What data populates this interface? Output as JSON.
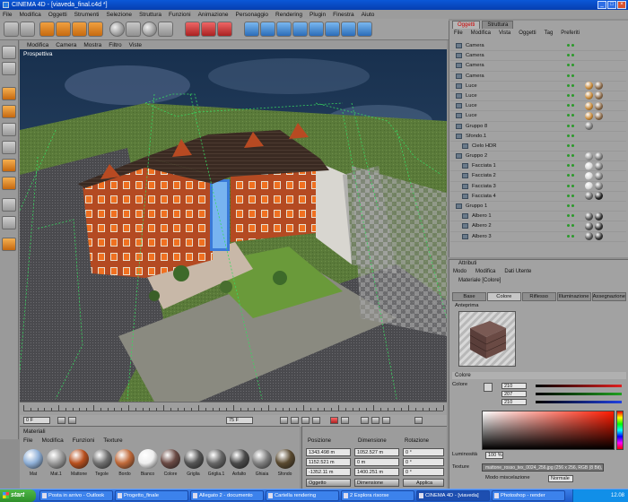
{
  "window": {
    "title": "CINEMA 4D - [viaveda_final.c4d *]"
  },
  "menu": [
    "File",
    "Modifica",
    "Oggetti",
    "Strumenti",
    "Selezione",
    "Struttura",
    "Funzioni",
    "Animazione",
    "Personaggio",
    "Rendering",
    "Plugin",
    "Finestra",
    "Aiuto"
  ],
  "viewport": {
    "menu": [
      "Modifica",
      "Camera",
      "Mostra",
      "Filtro",
      "Viste"
    ],
    "label": "Prospettiva"
  },
  "timeline": {
    "start_field": "0 F",
    "end_field": "75 F"
  },
  "material_manager": {
    "title": "Materiali",
    "menu": [
      "File",
      "Modifica",
      "Funzioni",
      "Texture"
    ],
    "materials": [
      {
        "name": "Mat",
        "color": "#8fb0d8"
      },
      {
        "name": "Mat.1",
        "color": "#9a9a9a"
      },
      {
        "name": "Mattone",
        "color": "#b8501e"
      },
      {
        "name": "Tegole",
        "color": "#707070"
      },
      {
        "name": "Bordo",
        "color": "#c06a3a"
      },
      {
        "name": "Bianco",
        "color": "#eeeeee"
      },
      {
        "name": "Colore",
        "color": "#6a4a44"
      },
      {
        "name": "Griglia",
        "color": "#555555"
      },
      {
        "name": "Griglia.1",
        "color": "#666666"
      },
      {
        "name": "Asfalto",
        "color": "#4a4a4a"
      },
      {
        "name": "Ghiaia",
        "color": "#808080"
      },
      {
        "name": "Sfondo",
        "color": "#5a4a30"
      }
    ]
  },
  "coordinates": {
    "headers": [
      "Posizione",
      "Dimensione",
      "Rotazione"
    ],
    "rows": [
      {
        "pos": "1343.498 m",
        "size": "1052.527 m",
        "rot": "0 °"
      },
      {
        "pos": "1152.521 m",
        "size": "0 m",
        "rot": "0 °"
      },
      {
        "pos": "-1352.11 m",
        "size": "1400.251 m",
        "rot": "0 °"
      }
    ],
    "mode": "Oggetto",
    "size_mode": "Dimensione",
    "apply_label": "Applica"
  },
  "object_manager": {
    "tabs": [
      "Oggetti",
      "Struttura"
    ],
    "menu": [
      "File",
      "Modifica",
      "Vista",
      "Oggetti",
      "Tag",
      "Preferiti"
    ],
    "rows": [
      {
        "name": "Camera",
        "indent": 0,
        "tags": []
      },
      {
        "name": "Camera",
        "indent": 0,
        "tags": []
      },
      {
        "name": "Camera",
        "indent": 0,
        "tags": []
      },
      {
        "name": "Camera",
        "indent": 0,
        "tags": []
      },
      {
        "name": "Luce",
        "indent": 0,
        "tags": [
          "#c88a3a",
          "#8a6a4a"
        ]
      },
      {
        "name": "Luce",
        "indent": 0,
        "tags": [
          "#c88a3a",
          "#8a6a4a"
        ]
      },
      {
        "name": "Luce",
        "indent": 0,
        "tags": [
          "#c88a3a",
          "#8a6a4a"
        ]
      },
      {
        "name": "Luce",
        "indent": 0,
        "tags": [
          "#c88a3a",
          "#8a6a4a"
        ]
      },
      {
        "name": "Gruppo 8",
        "indent": 0,
        "tags": [
          "#777777"
        ]
      },
      {
        "name": "Sfondo.1",
        "indent": 0,
        "tags": []
      },
      {
        "name": "Cielo HDR",
        "indent": 1,
        "tags": []
      },
      {
        "name": "Gruppo 2",
        "indent": 0,
        "tags": [
          "#9a9a9a",
          "#777777"
        ]
      },
      {
        "name": "Facciata 1",
        "indent": 1,
        "tags": [
          "#d8d8d8",
          "#777777"
        ]
      },
      {
        "name": "Facciata 2",
        "indent": 1,
        "tags": [
          "#d8d8d8",
          "#777777"
        ]
      },
      {
        "name": "Facciata 3",
        "indent": 1,
        "tags": [
          "#d8d8d8",
          "#777777"
        ]
      },
      {
        "name": "Facciata 4",
        "indent": 1,
        "tags": [
          "#666666",
          "#222222"
        ]
      },
      {
        "name": "Gruppo 1",
        "indent": 0,
        "tags": []
      },
      {
        "name": "Albero 1",
        "indent": 1,
        "tags": [
          "#555555",
          "#333333"
        ]
      },
      {
        "name": "Albero 2",
        "indent": 1,
        "tags": [
          "#555555",
          "#333333"
        ]
      },
      {
        "name": "Albero 3",
        "indent": 1,
        "tags": [
          "#555555",
          "#333333"
        ]
      }
    ]
  },
  "attribute_manager": {
    "title": "Attributi",
    "menu": [
      "Modo",
      "Modifica",
      "Dati Utente"
    ],
    "material_name": "Materiale [Colore]",
    "tabs": [
      "Base",
      "Colore",
      "Riflesso",
      "Illuminazione",
      "Assegnazione"
    ],
    "active_tab": "Colore",
    "sub_label": "Anteprima",
    "section": "Colore",
    "color_label": "Colore",
    "rgb": [
      {
        "value": "210",
        "color": "#e02020"
      },
      {
        "value": "207",
        "color": "#20a020"
      },
      {
        "value": "210",
        "color": "#2040e0"
      }
    ],
    "brightness_label": "Luminosità",
    "brightness_value": "100 %",
    "texture_label": "Texture",
    "texture_path": "mattone_rosso_tex_0024_256.jpg (256 x 256, RGB (8 Bit), sRGB IEC61966-2.1)",
    "blend_label": "Modo miscelazione",
    "blend_value": "Normale"
  },
  "taskbar": {
    "start_label": "start",
    "tasks": [
      {
        "label": "Posta in arrivo - Outlook",
        "active": false
      },
      {
        "label": "Progetto_finale",
        "active": false
      },
      {
        "label": "Allegato 2 - documento",
        "active": false
      },
      {
        "label": "Cartella rendering",
        "active": false
      },
      {
        "label": "2 Esplora risorse",
        "active": false
      },
      {
        "label": "CINEMA 4D - [viaveda]",
        "active": true
      },
      {
        "label": "Photoshop - render",
        "active": false
      }
    ],
    "clock": "12.08"
  }
}
